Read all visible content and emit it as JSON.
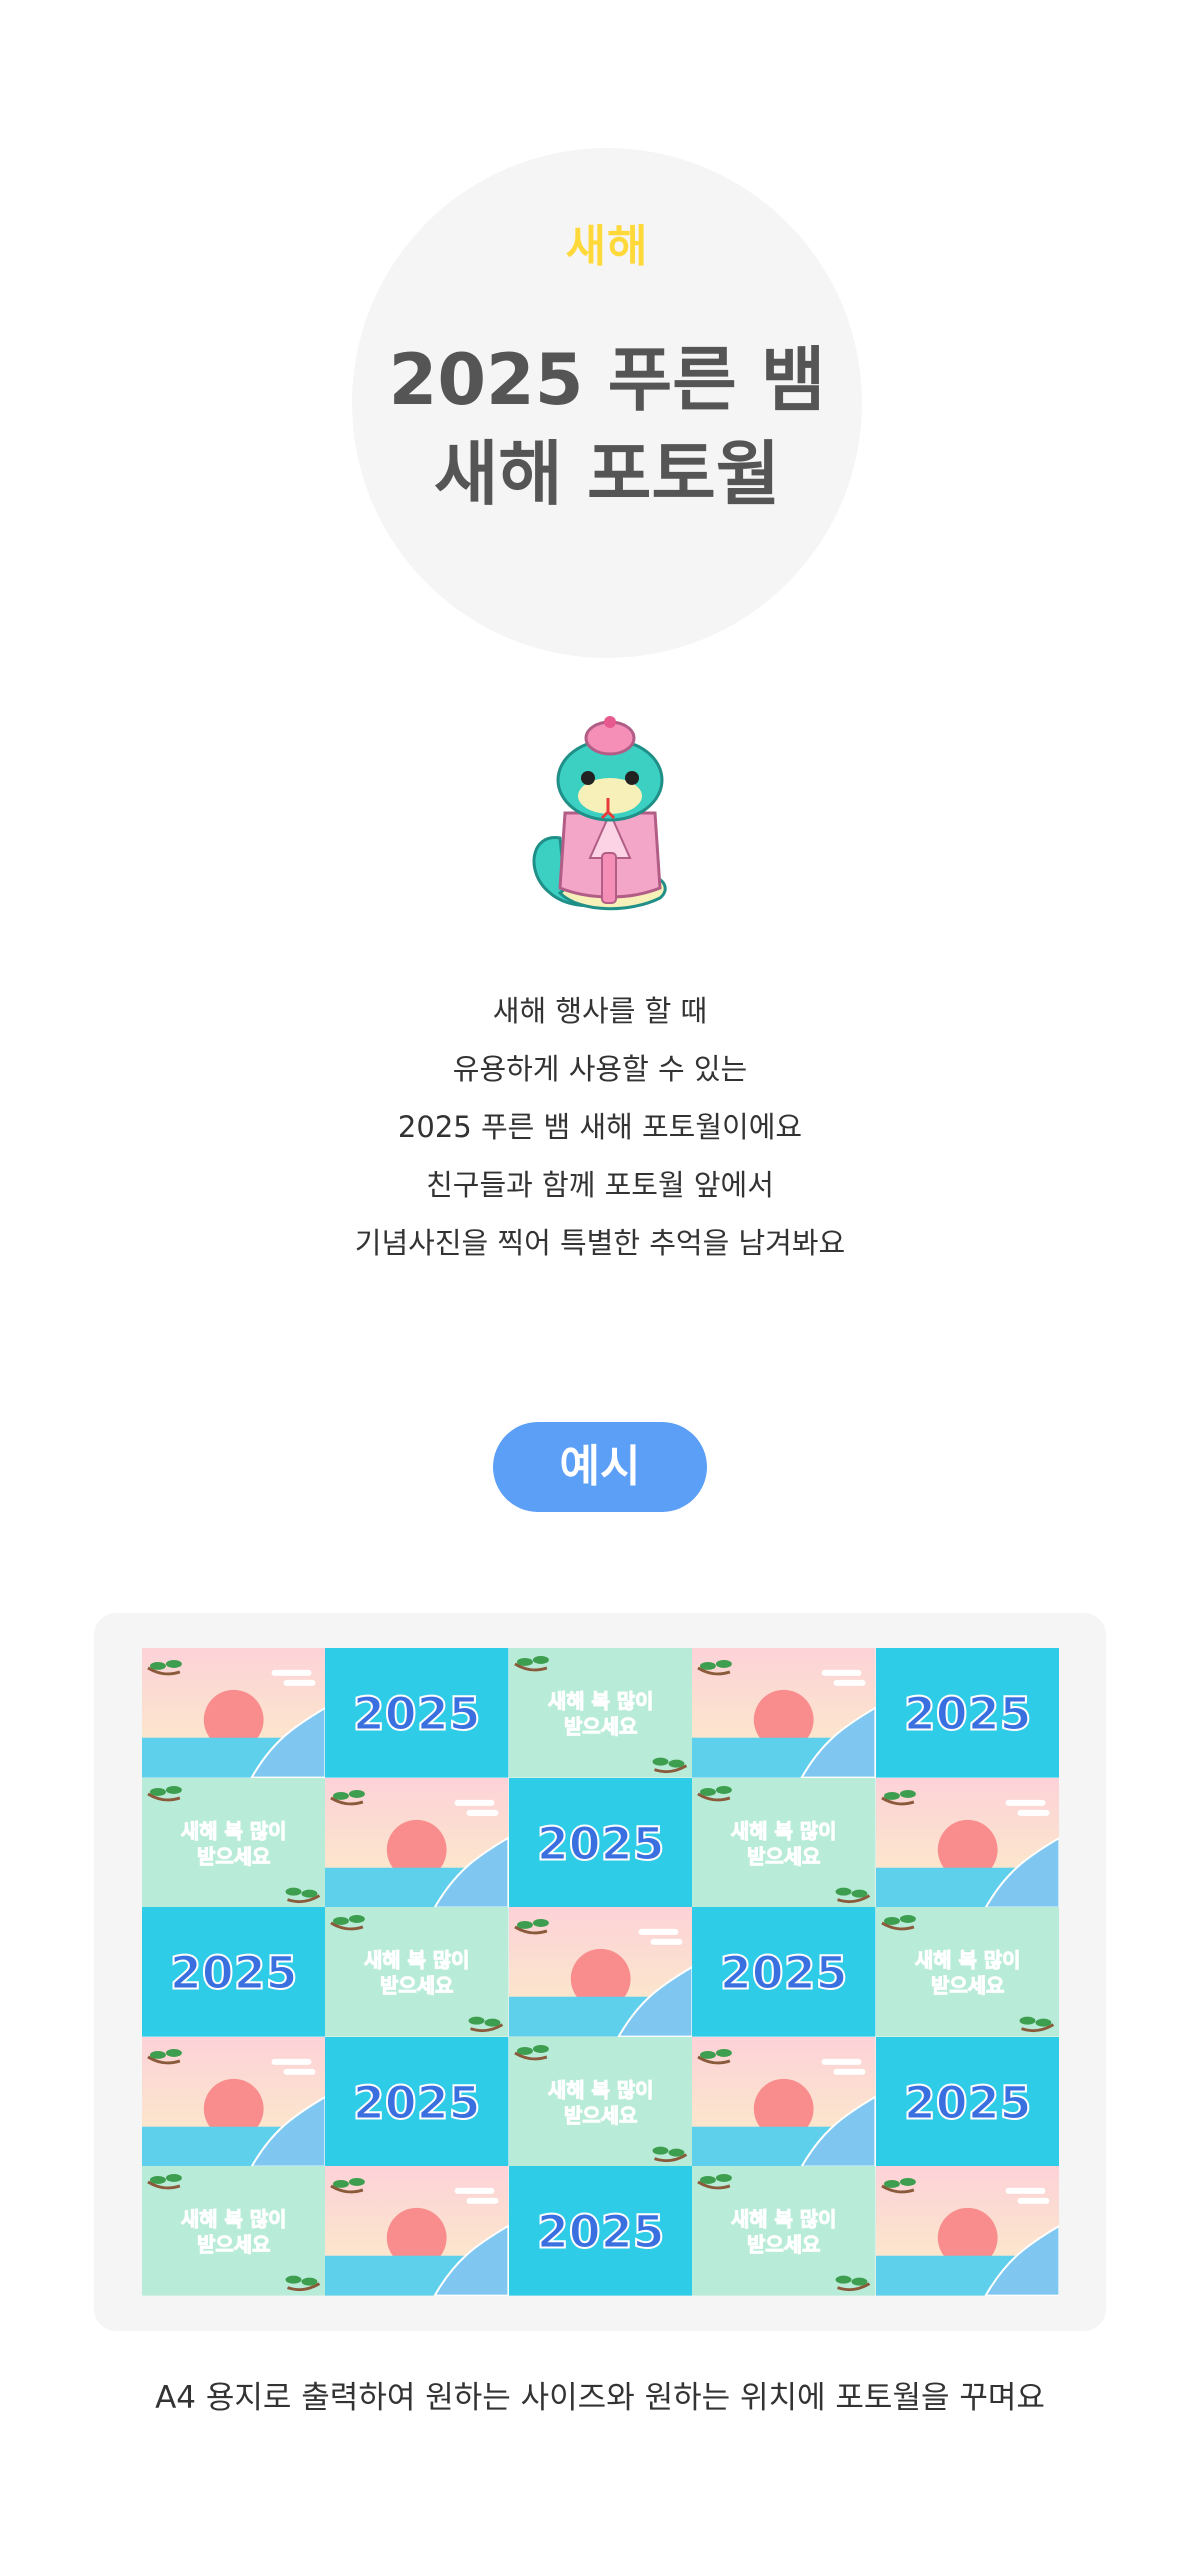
{
  "hero": {
    "eyebrow": "새해",
    "title_line1": "2025 푸른 뱀",
    "title_line2": "새해 포토월"
  },
  "description": [
    "새해 행사를 할 때",
    "유용하게 사용할 수 있는",
    "2025 푸른 뱀 새해 포토월이에요",
    "친구들과 함께 포토월 앞에서",
    "기념사진을 찍어 특별한 추억을 남겨봐요"
  ],
  "example_label": "예시",
  "preview": {
    "tile_texts": {
      "year": "2025",
      "greeting_line1": "새해 복 많이",
      "greeting_line2": "받으세요"
    },
    "rows": [
      [
        "sunrise",
        "year",
        "greeting",
        "sunrise",
        "year"
      ],
      [
        "greeting",
        "sunrise",
        "year",
        "greeting",
        "sunrise"
      ],
      [
        "year",
        "greeting",
        "sunrise",
        "year",
        "greeting"
      ],
      [
        "sunrise",
        "year",
        "greeting",
        "sunrise",
        "year"
      ],
      [
        "greeting",
        "sunrise",
        "year",
        "greeting",
        "sunrise"
      ]
    ],
    "colors": {
      "year_bg": "#2fcce8",
      "greeting_bg": "#b8ecd8",
      "sky_top": "#fdd2d8",
      "sky_bottom": "#fbeec8",
      "sun": "#f98d8d",
      "sea": "#5fd0ec",
      "year_text": "#3a6fe0"
    }
  },
  "caption": "A4 용지로 출력하여 원하는 사이즈와 원하는 위치에 포토월을 꾸며요"
}
